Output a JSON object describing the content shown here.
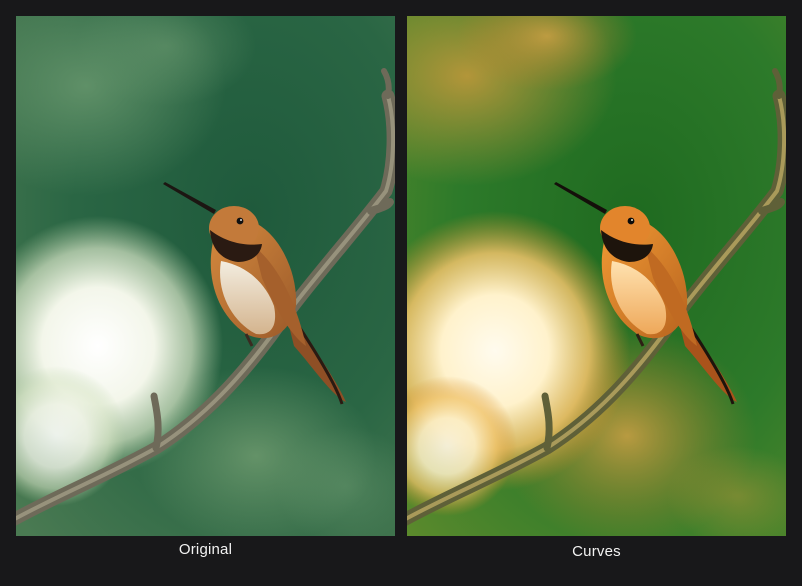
{
  "comparison": {
    "left": {
      "caption": "Original",
      "scene": "hummingbird-on-branch",
      "palette": {
        "background": "#2f6a46",
        "bokeh": "#f3f6ea",
        "bird_body": "#c8813f",
        "bird_throat": "#2a1a12",
        "branch": "#7c7563"
      }
    },
    "right": {
      "caption": "Curves",
      "scene": "hummingbird-on-branch",
      "palette": {
        "background": "#2f7a2c",
        "bokeh": "#fff4d0",
        "bird_body": "#ea8c2a",
        "bird_throat": "#1d140c",
        "branch": "#6f7046"
      }
    }
  },
  "colors": {
    "page_background": "#18181a",
    "caption_text": "#f2f2f2"
  }
}
